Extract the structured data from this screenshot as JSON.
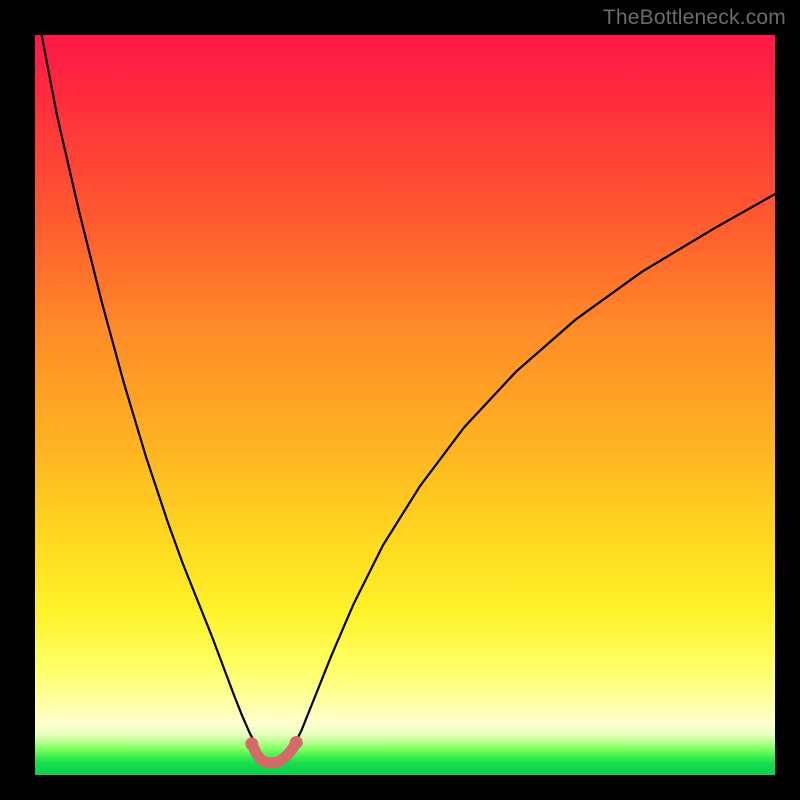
{
  "watermark": "TheBottleneck.com",
  "chart_data": {
    "type": "line",
    "title": "",
    "xlabel": "",
    "ylabel": "",
    "xlim": [
      0,
      100
    ],
    "ylim": [
      0,
      100
    ],
    "grid": false,
    "legend": false,
    "series": [
      {
        "name": "bottleneck-curve",
        "color": "#000000",
        "x": [
          0.9,
          3,
          6,
          9,
          12,
          15,
          18,
          20,
          22,
          24,
          25.5,
          27,
          28,
          29,
          30,
          30.8,
          31.4,
          31.8,
          32.2,
          33.2,
          34,
          35,
          36,
          37,
          38,
          40,
          43,
          47,
          52,
          58,
          65,
          73,
          82,
          92,
          100
        ],
        "values": [
          100,
          89,
          76,
          64,
          53,
          43,
          34,
          28.5,
          23.5,
          18.5,
          14.5,
          10.5,
          8,
          5.7,
          3.8,
          2.5,
          1.8,
          1.6,
          1.6,
          1.8,
          2.5,
          4,
          6,
          8.5,
          11,
          16,
          23,
          31,
          39,
          47,
          54.5,
          61.5,
          68,
          74,
          78.5
        ]
      },
      {
        "name": "sweet-spot-marker",
        "type": "scatter",
        "color": "#d46a6a",
        "x": [
          29.3,
          29.9,
          30.5,
          31.2,
          32.0,
          33.0,
          33.9,
          34.7,
          35.3
        ],
        "values": [
          4.2,
          2.9,
          2.1,
          1.7,
          1.6,
          1.8,
          2.5,
          3.4,
          4.4
        ]
      }
    ],
    "background_gradient": {
      "orientation": "vertical",
      "stops": [
        {
          "pos": 0.0,
          "color": "#ff1848"
        },
        {
          "pos": 0.25,
          "color": "#ff5a2f"
        },
        {
          "pos": 0.55,
          "color": "#ffb222"
        },
        {
          "pos": 0.78,
          "color": "#fff22a"
        },
        {
          "pos": 0.93,
          "color": "#ffffd0"
        },
        {
          "pos": 0.97,
          "color": "#7fff60"
        },
        {
          "pos": 1.0,
          "color": "#0cd048"
        }
      ]
    }
  }
}
